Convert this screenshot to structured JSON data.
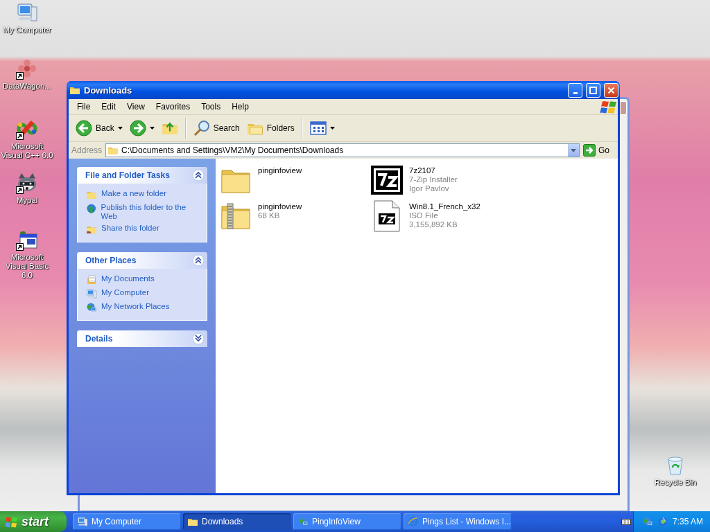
{
  "desktop_icons": [
    {
      "label": "My Computer",
      "kind": "computer",
      "shortcut": false
    },
    {
      "label": "DataWagon...",
      "kind": "flower",
      "shortcut": true
    },
    {
      "label": "Microsoft Visual C++ 6.0",
      "kind": "vcpp",
      "shortcut": true
    },
    {
      "label": "Mypal",
      "kind": "raccoon",
      "shortcut": true
    },
    {
      "label": "Microsoft Visual Basic 6.0",
      "kind": "vb",
      "shortcut": true
    },
    {
      "label": "Recycle Bin",
      "kind": "recycle",
      "shortcut": false
    }
  ],
  "window": {
    "title": "Downloads",
    "menu": [
      "File",
      "Edit",
      "View",
      "Favorites",
      "Tools",
      "Help"
    ],
    "toolbar": {
      "back": "Back",
      "search": "Search",
      "folders": "Folders"
    },
    "address": {
      "label": "Address",
      "value": "C:\\Documents and Settings\\VM2\\My Documents\\Downloads",
      "go": "Go"
    },
    "panels": [
      {
        "title": "File and Folder Tasks",
        "expanded": true,
        "items": [
          {
            "label": "Make a new folder",
            "kind": "newfolder"
          },
          {
            "label": "Publish this folder to the Web",
            "kind": "globe"
          },
          {
            "label": "Share this folder",
            "kind": "share"
          }
        ]
      },
      {
        "title": "Other Places",
        "expanded": true,
        "items": [
          {
            "label": "My Documents",
            "kind": "documents"
          },
          {
            "label": "My Computer",
            "kind": "computer"
          },
          {
            "label": "My Network Places",
            "kind": "network"
          }
        ]
      },
      {
        "title": "Details",
        "expanded": false
      }
    ],
    "files": [
      {
        "name": "pinginfoview",
        "kind": "folder"
      },
      {
        "name": "7z2107",
        "kind": "app",
        "details": [
          "7-Zip Installer",
          "Igor Pavlov"
        ]
      },
      {
        "name": "pinginfoview",
        "kind": "zip",
        "details": [
          "68 KB"
        ]
      },
      {
        "name": "Win8.1_French_x32",
        "kind": "archive",
        "details": [
          "ISO File",
          "3,155,892 KB"
        ]
      }
    ]
  },
  "taskbar": {
    "start": "start",
    "tasks": [
      {
        "label": "My Computer",
        "kind": "computer",
        "selected": false
      },
      {
        "label": "Downloads",
        "kind": "folder",
        "selected": true
      },
      {
        "label": "PingInfoView",
        "kind": "network",
        "selected": false
      },
      {
        "label": "Pings List - Windows I...",
        "kind": "ie",
        "selected": false
      }
    ],
    "clock": "7:35 AM"
  }
}
